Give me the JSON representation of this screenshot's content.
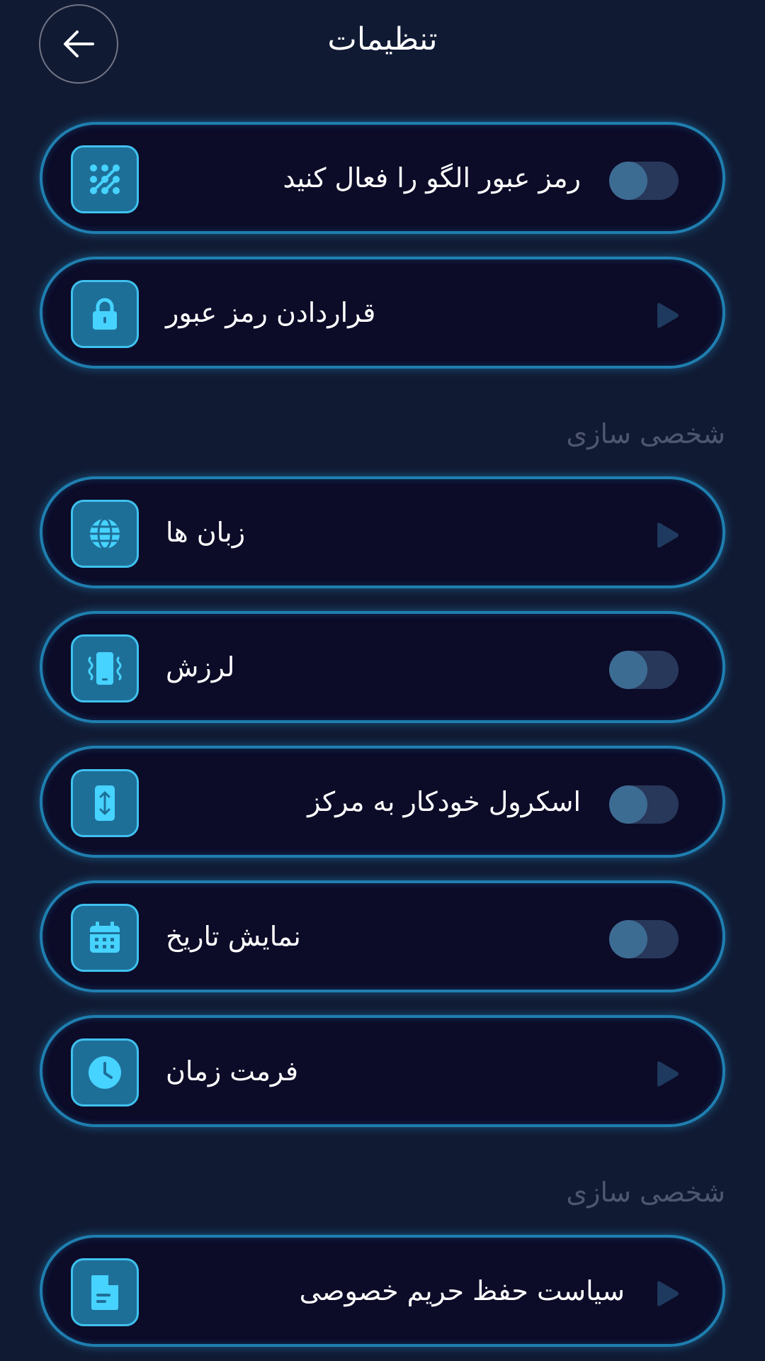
{
  "header": {
    "title": "تنظیمات",
    "back_icon": "arrow-left-icon"
  },
  "items_top": [
    {
      "label": "رمز عبور الگو را فعال کنید",
      "icon": "pattern-icon",
      "control": "toggle",
      "on": false
    },
    {
      "label": "قراردادن رمز عبور",
      "icon": "lock-icon",
      "control": "chevron"
    }
  ],
  "sections": [
    {
      "title": "شخصی سازی",
      "items": [
        {
          "label": "زبان ها",
          "icon": "globe-icon",
          "control": "chevron"
        },
        {
          "label": "لرزش",
          "icon": "vibrate-icon",
          "control": "toggle",
          "on": false
        },
        {
          "label": "اسکرول خودکار به مرکز",
          "icon": "scroll-vertical-icon",
          "control": "toggle",
          "on": false
        },
        {
          "label": "نمایش تاریخ",
          "icon": "calendar-icon",
          "control": "toggle",
          "on": false
        },
        {
          "label": "فرمت زمان",
          "icon": "clock-icon",
          "control": "chevron"
        }
      ]
    },
    {
      "title": "شخصی سازی",
      "items": [
        {
          "label": "سیاست حفظ حریم خصوصی",
          "icon": "document-icon",
          "control": "chevron"
        }
      ]
    }
  ],
  "colors": {
    "background": "#111a33",
    "card": "#0c0b28",
    "accent": "#3fc1ee",
    "section_title": "#4e5670"
  }
}
